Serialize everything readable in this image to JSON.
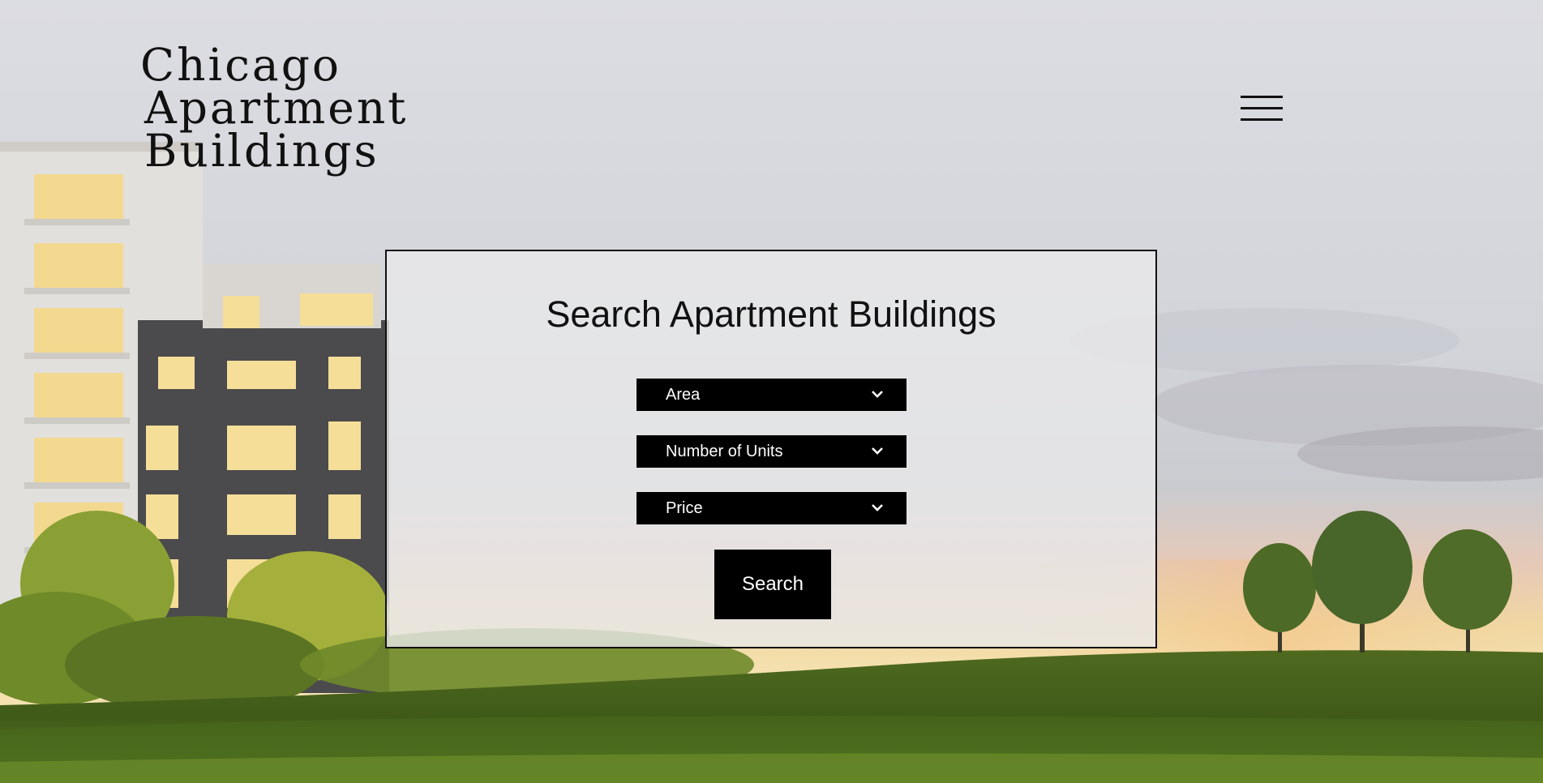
{
  "header": {
    "logo_lines": [
      "Chicago",
      "Apartment",
      "Buildings"
    ],
    "menu_icon": "hamburger-menu-icon"
  },
  "search": {
    "title": "Search Apartment Buildings",
    "area_label": "Area",
    "units_label": "Number of Units",
    "price_label": "Price",
    "dropdown_icon": "chevron-down-icon",
    "button_label": "Search"
  },
  "colors": {
    "panel_bg": "#e8e8ea",
    "control_bg": "#000000",
    "control_text": "#ffffff",
    "text": "#111111"
  }
}
